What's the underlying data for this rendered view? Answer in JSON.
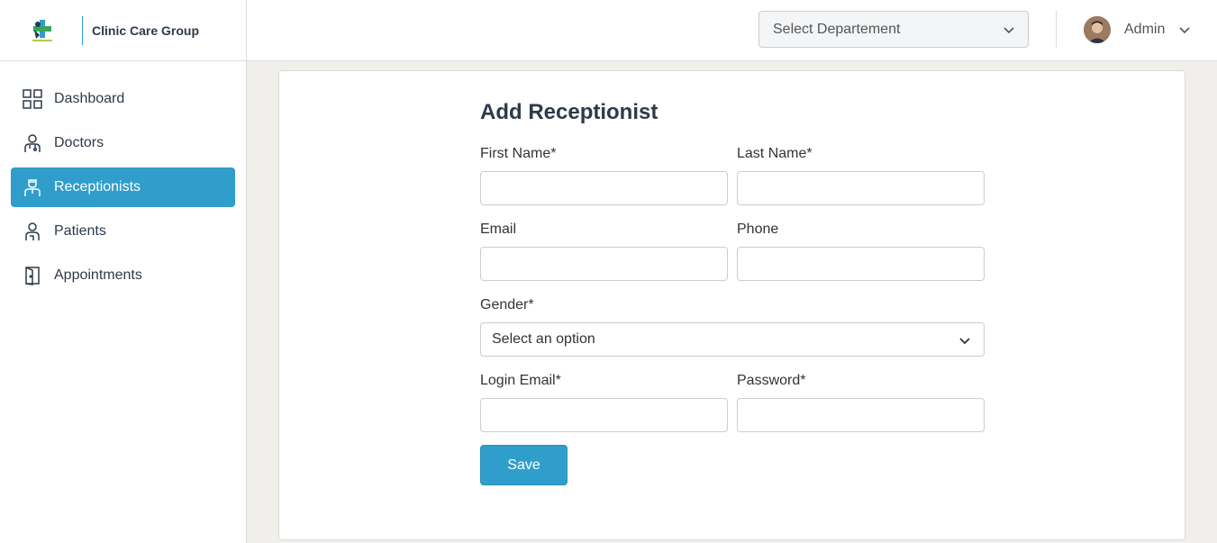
{
  "brand": {
    "name": "Clinic Care Group"
  },
  "sidebar": {
    "items": [
      {
        "label": "Dashboard",
        "icon": "dashboard-grid-icon",
        "active": false
      },
      {
        "label": "Doctors",
        "icon": "doctor-icon",
        "active": false
      },
      {
        "label": "Receptionists",
        "icon": "receptionist-icon",
        "active": true
      },
      {
        "label": "Patients",
        "icon": "patient-icon",
        "active": false
      },
      {
        "label": "Appointments",
        "icon": "door-icon",
        "active": false
      }
    ]
  },
  "header": {
    "department_select": {
      "value": "Select Departement"
    },
    "user": {
      "name": "Admin"
    }
  },
  "form": {
    "title": "Add Receptionist",
    "fields": {
      "first_name": {
        "label": "First Name*",
        "value": ""
      },
      "last_name": {
        "label": "Last Name*",
        "value": ""
      },
      "email": {
        "label": "Email",
        "value": ""
      },
      "phone": {
        "label": "Phone",
        "value": ""
      },
      "gender": {
        "label": "Gender*",
        "value": "Select an option"
      },
      "login_email": {
        "label": "Login Email*",
        "value": ""
      },
      "password": {
        "label": "Password*",
        "value": ""
      }
    },
    "save_label": "Save"
  },
  "colors": {
    "accent": "#2f9ecb",
    "background": "#f0efeb",
    "text": "#2d3a4a"
  }
}
